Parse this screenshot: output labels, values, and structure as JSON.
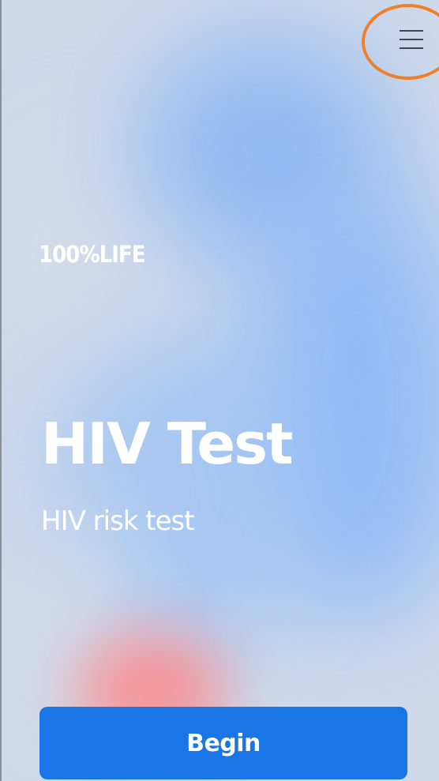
{
  "header": {
    "menu_icon": "hamburger-menu-icon"
  },
  "brand": {
    "logo_text": "100%LIFE"
  },
  "hero": {
    "title": "HIV Test",
    "subtitle": "HIV risk test"
  },
  "actions": {
    "begin_label": "Begin"
  },
  "colors": {
    "background": "#cfd9ea",
    "accent_blue": "#1a75e6",
    "annotation_orange": "#f07f2a",
    "text": "#ffffff"
  }
}
